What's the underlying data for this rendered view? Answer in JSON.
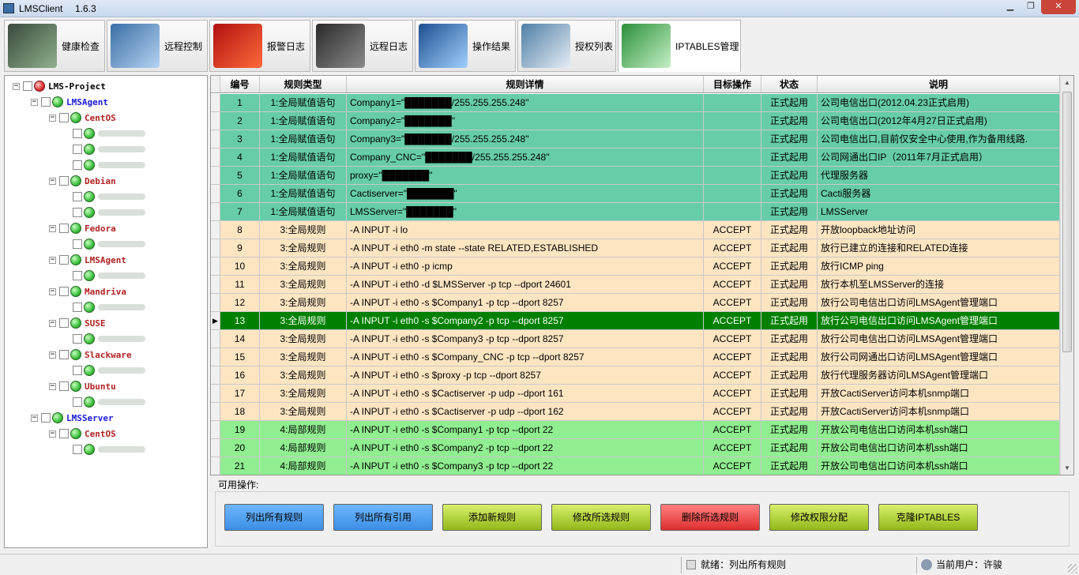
{
  "window": {
    "title": "LMSClient",
    "version": "1.6.3"
  },
  "toolbar": {
    "tabs": [
      {
        "label": "健康检查",
        "icon": "heart-monitor-icon"
      },
      {
        "label": "远程控制",
        "icon": "remote-control-icon"
      },
      {
        "label": "报警日志",
        "icon": "alarm-siren-icon"
      },
      {
        "label": "远程日志",
        "icon": "remote-log-icon"
      },
      {
        "label": "操作结果",
        "icon": "operation-result-icon"
      },
      {
        "label": "授权列表",
        "icon": "certificate-icon"
      },
      {
        "label": "IPTABLES管理",
        "icon": "firewall-shield-icon"
      }
    ],
    "active_tab": "IPTABLES管理"
  },
  "tree": {
    "root": "LMS-Project",
    "nodes": [
      {
        "label": "LMSAgent",
        "level": 1
      },
      {
        "label": "CentOS",
        "level": 2
      },
      {
        "label": "",
        "level": 3
      },
      {
        "label": "",
        "level": 3
      },
      {
        "label": "",
        "level": 3
      },
      {
        "label": "Debian",
        "level": 2
      },
      {
        "label": "",
        "level": 3
      },
      {
        "label": "",
        "level": 3
      },
      {
        "label": "Fedora",
        "level": 2
      },
      {
        "label": "",
        "level": 3
      },
      {
        "label": "LMSAgent",
        "level": 2
      },
      {
        "label": "",
        "level": 3
      },
      {
        "label": "Mandriva",
        "level": 2
      },
      {
        "label": "",
        "level": 3
      },
      {
        "label": "SUSE",
        "level": 2
      },
      {
        "label": "",
        "level": 3
      },
      {
        "label": "Slackware",
        "level": 2
      },
      {
        "label": "",
        "level": 3
      },
      {
        "label": "Ubuntu",
        "level": 2
      },
      {
        "label": "",
        "level": 3
      },
      {
        "label": "LMSServer",
        "level": 1
      },
      {
        "label": "CentOS",
        "level": 2
      },
      {
        "label": "",
        "level": 3
      }
    ]
  },
  "grid": {
    "columns": [
      "编号",
      "规则类型",
      "规则详情",
      "目标操作",
      "状态",
      "说明"
    ],
    "selected_row": "13",
    "rows": [
      {
        "no": "1",
        "type": "1:全局赋值语句",
        "detail": "Company1=\"███████/255.255.255.248\"",
        "target": "",
        "status": "正式起用",
        "desc": "公司电信出口(2012.04.23正式启用)",
        "group": "teal"
      },
      {
        "no": "2",
        "type": "1:全局赋值语句",
        "detail": "Company2=\"███████\"",
        "target": "",
        "status": "正式起用",
        "desc": "公司电信出口(2012年4月27日正式启用)",
        "group": "teal"
      },
      {
        "no": "3",
        "type": "1:全局赋值语句",
        "detail": "Company3=\"███████/255.255.255.248\"",
        "target": "",
        "status": "正式起用",
        "desc": "公司电信出口,目前仅安全中心使用,作为备用线路.",
        "group": "teal"
      },
      {
        "no": "4",
        "type": "1:全局赋值语句",
        "detail": "Company_CNC=\"███████/255.255.255.248\"",
        "target": "",
        "status": "正式起用",
        "desc": "公司网通出口IP（2011年7月正式启用）",
        "group": "teal"
      },
      {
        "no": "5",
        "type": "1:全局赋值语句",
        "detail": "proxy=\"███████\"",
        "target": "",
        "status": "正式起用",
        "desc": "代理服务器",
        "group": "teal"
      },
      {
        "no": "6",
        "type": "1:全局赋值语句",
        "detail": "Cactiserver=\"███████\"",
        "target": "",
        "status": "正式起用",
        "desc": "Cacti服务器",
        "group": "teal"
      },
      {
        "no": "7",
        "type": "1:全局赋值语句",
        "detail": "LMSServer=\"███████\"",
        "target": "",
        "status": "正式起用",
        "desc": "LMSServer",
        "group": "teal"
      },
      {
        "no": "8",
        "type": "3:全局规则",
        "detail": "-A INPUT -i lo",
        "target": "ACCEPT",
        "status": "正式起用",
        "desc": "开放loopback地址访问",
        "group": "peach"
      },
      {
        "no": "9",
        "type": "3:全局规则",
        "detail": "-A INPUT -i eth0 -m state --state RELATED,ESTABLISHED",
        "target": "ACCEPT",
        "status": "正式起用",
        "desc": "放行已建立的连接和RELATED连接",
        "group": "peach"
      },
      {
        "no": "10",
        "type": "3:全局规则",
        "detail": "-A INPUT -i eth0 -p icmp",
        "target": "ACCEPT",
        "status": "正式起用",
        "desc": "放行ICMP ping",
        "group": "peach"
      },
      {
        "no": "11",
        "type": "3:全局规则",
        "detail": "-A INPUT -i eth0 -d $LMSServer -p tcp --dport 24601",
        "target": "ACCEPT",
        "status": "正式起用",
        "desc": "放行本机至LMSServer的连接",
        "group": "peach"
      },
      {
        "no": "12",
        "type": "3:全局规则",
        "detail": "-A INPUT -i eth0 -s $Company1 -p tcp --dport 8257",
        "target": "ACCEPT",
        "status": "正式起用",
        "desc": "放行公司电信出口访问LMSAgent管理端口",
        "group": "peach"
      },
      {
        "no": "13",
        "type": "3:全局规则",
        "detail": "-A INPUT -i eth0 -s $Company2 -p tcp --dport 8257",
        "target": "ACCEPT",
        "status": "正式起用",
        "desc": "放行公司电信出口访问LMSAgent管理端口",
        "group": "selected"
      },
      {
        "no": "14",
        "type": "3:全局规则",
        "detail": "-A INPUT -i eth0 -s $Company3 -p tcp --dport 8257",
        "target": "ACCEPT",
        "status": "正式起用",
        "desc": "放行公司电信出口访问LMSAgent管理端口",
        "group": "peach"
      },
      {
        "no": "15",
        "type": "3:全局规则",
        "detail": "-A INPUT -i eth0 -s $Company_CNC -p tcp --dport 8257",
        "target": "ACCEPT",
        "status": "正式起用",
        "desc": "放行公司网通出口访问LMSAgent管理端口",
        "group": "peach"
      },
      {
        "no": "16",
        "type": "3:全局规则",
        "detail": "-A INPUT -i eth0 -s $proxy -p tcp --dport 8257",
        "target": "ACCEPT",
        "status": "正式起用",
        "desc": "放行代理服务器访问LMSAgent管理端口",
        "group": "peach"
      },
      {
        "no": "17",
        "type": "3:全局规则",
        "detail": "-A INPUT -i eth0 -s $Cactiserver -p udp --dport 161",
        "target": "ACCEPT",
        "status": "正式起用",
        "desc": "开放CactiServer访问本机snmp端口",
        "group": "peach"
      },
      {
        "no": "18",
        "type": "3:全局规则",
        "detail": "-A INPUT -i eth0 -s $Cactiserver -p udp --dport 162",
        "target": "ACCEPT",
        "status": "正式起用",
        "desc": "开放CactiServer访问本机snmp端口",
        "group": "peach"
      },
      {
        "no": "19",
        "type": "4:局部规则",
        "detail": "-A INPUT -i eth0 -s $Company1 -p tcp --dport 22",
        "target": "ACCEPT",
        "status": "正式起用",
        "desc": "开放公司电信出口访问本机ssh端口",
        "group": "green"
      },
      {
        "no": "20",
        "type": "4:局部规则",
        "detail": "-A INPUT -i eth0 -s $Company2 -p tcp --dport 22",
        "target": "ACCEPT",
        "status": "正式起用",
        "desc": "开放公司电信出口访问本机ssh端口",
        "group": "green"
      },
      {
        "no": "21",
        "type": "4:局部规则",
        "detail": "-A INPUT -i eth0 -s $Company3 -p tcp --dport 22",
        "target": "ACCEPT",
        "status": "正式起用",
        "desc": "开放公司电信出口访问本机ssh端口",
        "group": "green"
      }
    ]
  },
  "ops": {
    "title": "可用操作:",
    "buttons": [
      {
        "label": "列出所有规则",
        "style": "blue"
      },
      {
        "label": "列出所有引用",
        "style": "blue"
      },
      {
        "label": "添加新规则",
        "style": "green"
      },
      {
        "label": "修改所选规则",
        "style": "green"
      },
      {
        "label": "删除所选规则",
        "style": "red"
      },
      {
        "label": "修改权限分配",
        "style": "green"
      },
      {
        "label": "克隆IPTABLES",
        "style": "green"
      }
    ]
  },
  "status": {
    "message": "就绪：列出所有规则",
    "user": "当前用户：许骏"
  },
  "colors": {
    "teal": "#66cda8",
    "peach": "#fde5c2",
    "green": "#90ee90",
    "selected": "#008000",
    "level1": "#1a1ae0",
    "level2": "#b22222"
  }
}
